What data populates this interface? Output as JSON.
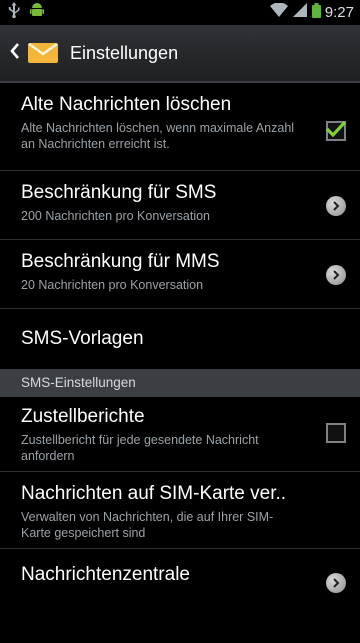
{
  "status_bar": {
    "time": "9:27"
  },
  "action_bar": {
    "title": "Einstellungen",
    "back_icon": "back-chevron-icon",
    "app_icon": "mail-envelope-icon"
  },
  "settings": {
    "delete_old": {
      "title": "Alte Nachrichten löschen",
      "subtitle": "Alte Nachrichten löschen, wenn maximale Anzahl an Nachrichten erreicht ist.",
      "checked": true
    },
    "sms_limit": {
      "title": "Beschränkung für SMS",
      "subtitle": "200 Nachrichten pro Konversation"
    },
    "mms_limit": {
      "title": "Beschränkung für MMS",
      "subtitle": "20 Nachrichten pro Konversation"
    },
    "sms_templates": {
      "title": "SMS-Vorlagen"
    }
  },
  "sms_section": {
    "header": "SMS-Einstellungen",
    "delivery_reports": {
      "title": "Zustellberichte",
      "subtitle": "Zustellbericht für jede gesendete Nachricht anfordern",
      "checked": false
    },
    "sim_messages": {
      "title": "Nachrichten auf SIM-Karte ver..",
      "subtitle": "Verwalten von Nachrichten, die auf Ihrer SIM-Karte gespeichert sind"
    },
    "message_center": {
      "title": "Nachrichtenzentrale"
    }
  },
  "colors": {
    "accent_check": "#7fd13b",
    "header_bg": "#3b3f44",
    "background": "#000000"
  }
}
